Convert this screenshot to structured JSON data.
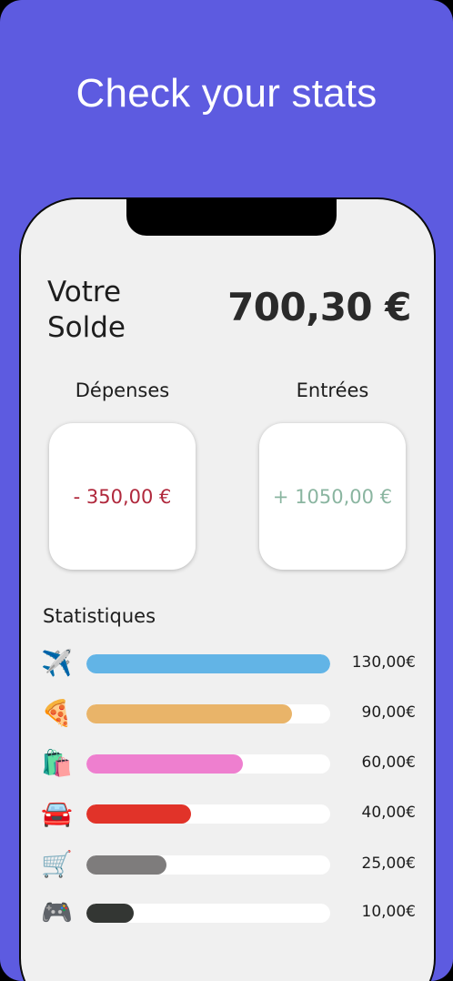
{
  "headline": "Check your stats",
  "balance": {
    "label": "Votre Solde",
    "amount": "700,30 €"
  },
  "expenses": {
    "label": "Dépenses",
    "amount": "- 350,00 €",
    "color": "#b0283c"
  },
  "income": {
    "label": "Entrées",
    "amount": "+ 1050,00 €",
    "color": "#8ab5a0"
  },
  "statistics": {
    "title": "Statistiques",
    "items": [
      {
        "icon": "airplane-icon",
        "glyph": "✈️",
        "amount": "130,00€",
        "fraction": 1.0,
        "color": "#62b4e6"
      },
      {
        "icon": "pizza-icon",
        "glyph": "🍕",
        "amount": "90,00€",
        "fraction": 0.845,
        "color": "#e9b469"
      },
      {
        "icon": "shopping-bags-icon",
        "glyph": "🛍️",
        "amount": "60,00€",
        "fraction": 0.64,
        "color": "#ee7fcf"
      },
      {
        "icon": "car-icon",
        "glyph": "🚘",
        "amount": "40,00€",
        "fraction": 0.43,
        "color": "#e13329"
      },
      {
        "icon": "shopping-cart-icon",
        "glyph": "🛒",
        "amount": "25,00€",
        "fraction": 0.33,
        "color": "#7e7c7c"
      },
      {
        "icon": "game-controller-icon",
        "glyph": "🎮",
        "amount": "10,00€",
        "fraction": 0.195,
        "color": "#333633"
      }
    ]
  },
  "colors": {
    "background": "#5d5be0",
    "phone": "#f0f0f0"
  }
}
